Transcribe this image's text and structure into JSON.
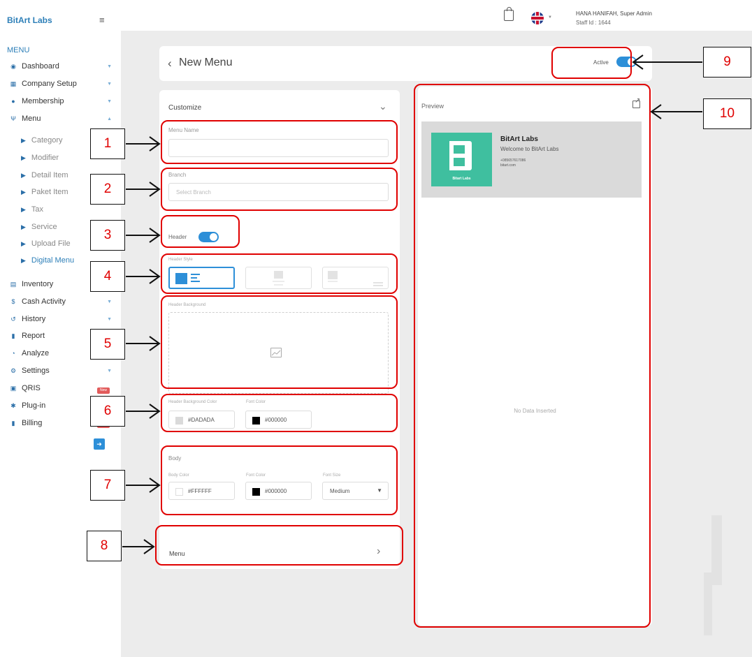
{
  "sidebar": {
    "brand": "BitArt Labs",
    "section_heading": "MENU",
    "items": [
      {
        "label": "Dashboard",
        "icon": "dashboard-icon"
      },
      {
        "label": "Company Setup",
        "icon": "building-icon"
      },
      {
        "label": "Membership",
        "icon": "users-icon"
      },
      {
        "label": "Menu",
        "icon": "utensils-icon"
      }
    ],
    "sub_items": [
      "Category",
      "Modifier",
      "Detail Item",
      "Paket Item",
      "Tax",
      "Service",
      "Upload File",
      "Digital Menu"
    ],
    "lower_items": [
      {
        "label": "Inventory",
        "icon": "inventory-icon"
      },
      {
        "label": "Cash Activity",
        "icon": "dollar-icon"
      },
      {
        "label": "History",
        "icon": "history-icon"
      },
      {
        "label": "Report",
        "icon": "report-icon"
      },
      {
        "label": "Analyze",
        "icon": "chart-icon"
      },
      {
        "label": "Settings",
        "icon": "gear-icon"
      },
      {
        "label": "QRIS",
        "icon": "qr-icon"
      },
      {
        "label": "Plug-in",
        "icon": "plugin-icon"
      },
      {
        "label": "Billing",
        "icon": "billing-icon"
      }
    ],
    "badge_new": "New",
    "active_sub": "Digital Menu"
  },
  "topbar": {
    "user_name": "HANA HANIFAH, Super Admin",
    "staff_id": "Staff Id : 1644"
  },
  "title_bar": {
    "title": "New Menu",
    "active_label": "Active",
    "active_on": true
  },
  "customize": {
    "section_label": "Customize",
    "menu_name_label": "Menu Name",
    "menu_name_value": "",
    "branch_label": "Branch",
    "branch_placeholder": "Select Branch",
    "header_label": "Header",
    "header_on": true,
    "header_style_label": "Header Style",
    "header_background_label": "Header Background",
    "header_bg_color_label": "Header Background Color",
    "header_bg_color_value": "#DADADA",
    "font_color_label": "Font Color",
    "font_color_value": "#000000",
    "body_label": "Body",
    "body_color_label": "Body Color",
    "body_color_value": "#FFFFFF",
    "body_font_color_label": "Font Color",
    "body_font_color_value": "#000000",
    "font_size_label": "Font Size",
    "font_size_value": "Medium",
    "menu_label": "Menu"
  },
  "preview": {
    "label": "Preview",
    "business_name": "BitArt Labs",
    "tagline": "Welcome to BitArt Labs",
    "phone": "+085657617086",
    "website": "bitart.com",
    "logo_caption": "Bitart Labs",
    "empty_text": "No Data Inserted"
  },
  "callouts": [
    "1",
    "2",
    "3",
    "4",
    "5",
    "6",
    "7",
    "8",
    "9",
    "10"
  ],
  "colors": {
    "accent": "#2d8fd8",
    "brand_text": "#2d7fb8",
    "logo_green": "#3fbf9f",
    "annotation_red": "#e00000",
    "header_bg": "#DADADA"
  }
}
